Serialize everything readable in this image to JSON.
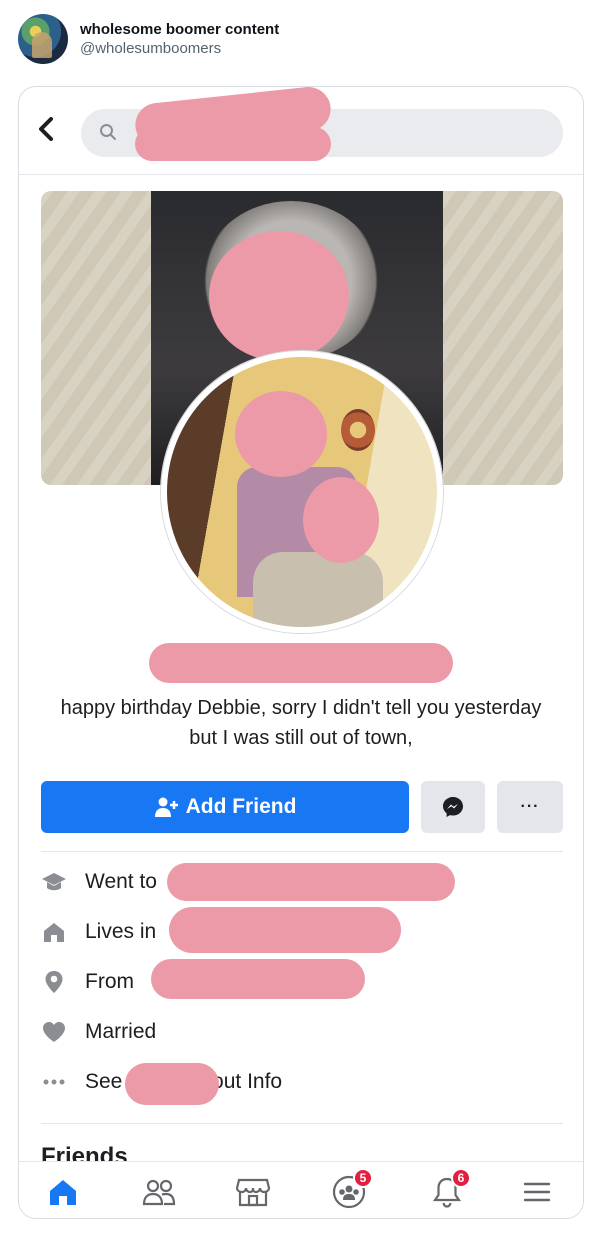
{
  "tweet": {
    "display_name": "wholesome boomer content",
    "handle": "@wholesumboomers"
  },
  "profile": {
    "bio": "happy birthday Debbie, sorry I didn't tell you yesterday but I was still out of town,",
    "add_friend_label": "Add Friend",
    "more_label": "···"
  },
  "about": {
    "went_to": "Went to",
    "lives_in": "Lives in",
    "from": "From",
    "married": "Married",
    "see_prefix": "See",
    "see_suffix": "bout Info"
  },
  "friends_title": "Friends",
  "tabbar": {
    "groups_badge": "5",
    "notifications_badge": "6"
  },
  "colors": {
    "accent": "#1877f2",
    "redaction": "#ec9aa7",
    "badge": "#e41e3f"
  }
}
